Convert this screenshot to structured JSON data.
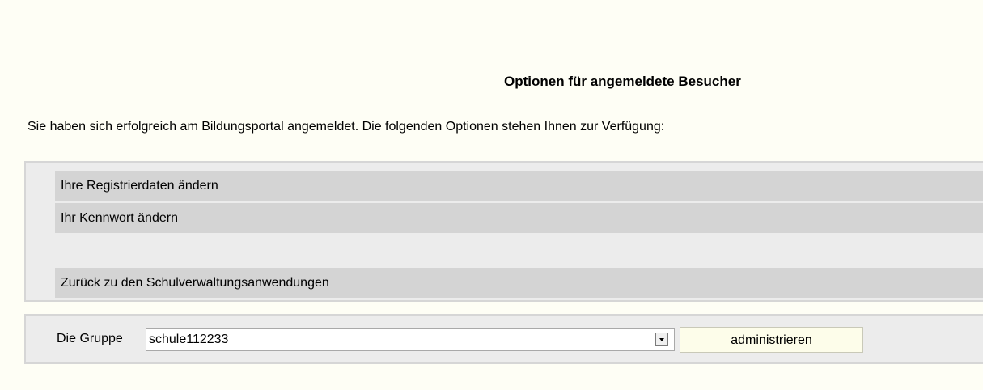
{
  "header": {
    "title": "Optionen für angemeldete Besucher"
  },
  "intro_text": "Sie haben sich erfolgreich am Bildungsportal angemeldet. Die folgenden Optionen stehen Ihnen zur Verfügung:",
  "options": {
    "edit_registration": "Ihre Registrierdaten ändern",
    "change_password": "Ihr Kennwort ändern",
    "back_to_apps": "Zurück zu den Schulverwaltungsanwendungen"
  },
  "group": {
    "label": "Die Gruppe",
    "selected": "schule112233",
    "dropdown_icon": "chevron-down-icon",
    "action_label": "administrieren"
  },
  "colors": {
    "page_background": "#fefef5",
    "panel_background": "#ececec",
    "link_background": "#d4d4d4",
    "button_background": "#fdfdea"
  }
}
